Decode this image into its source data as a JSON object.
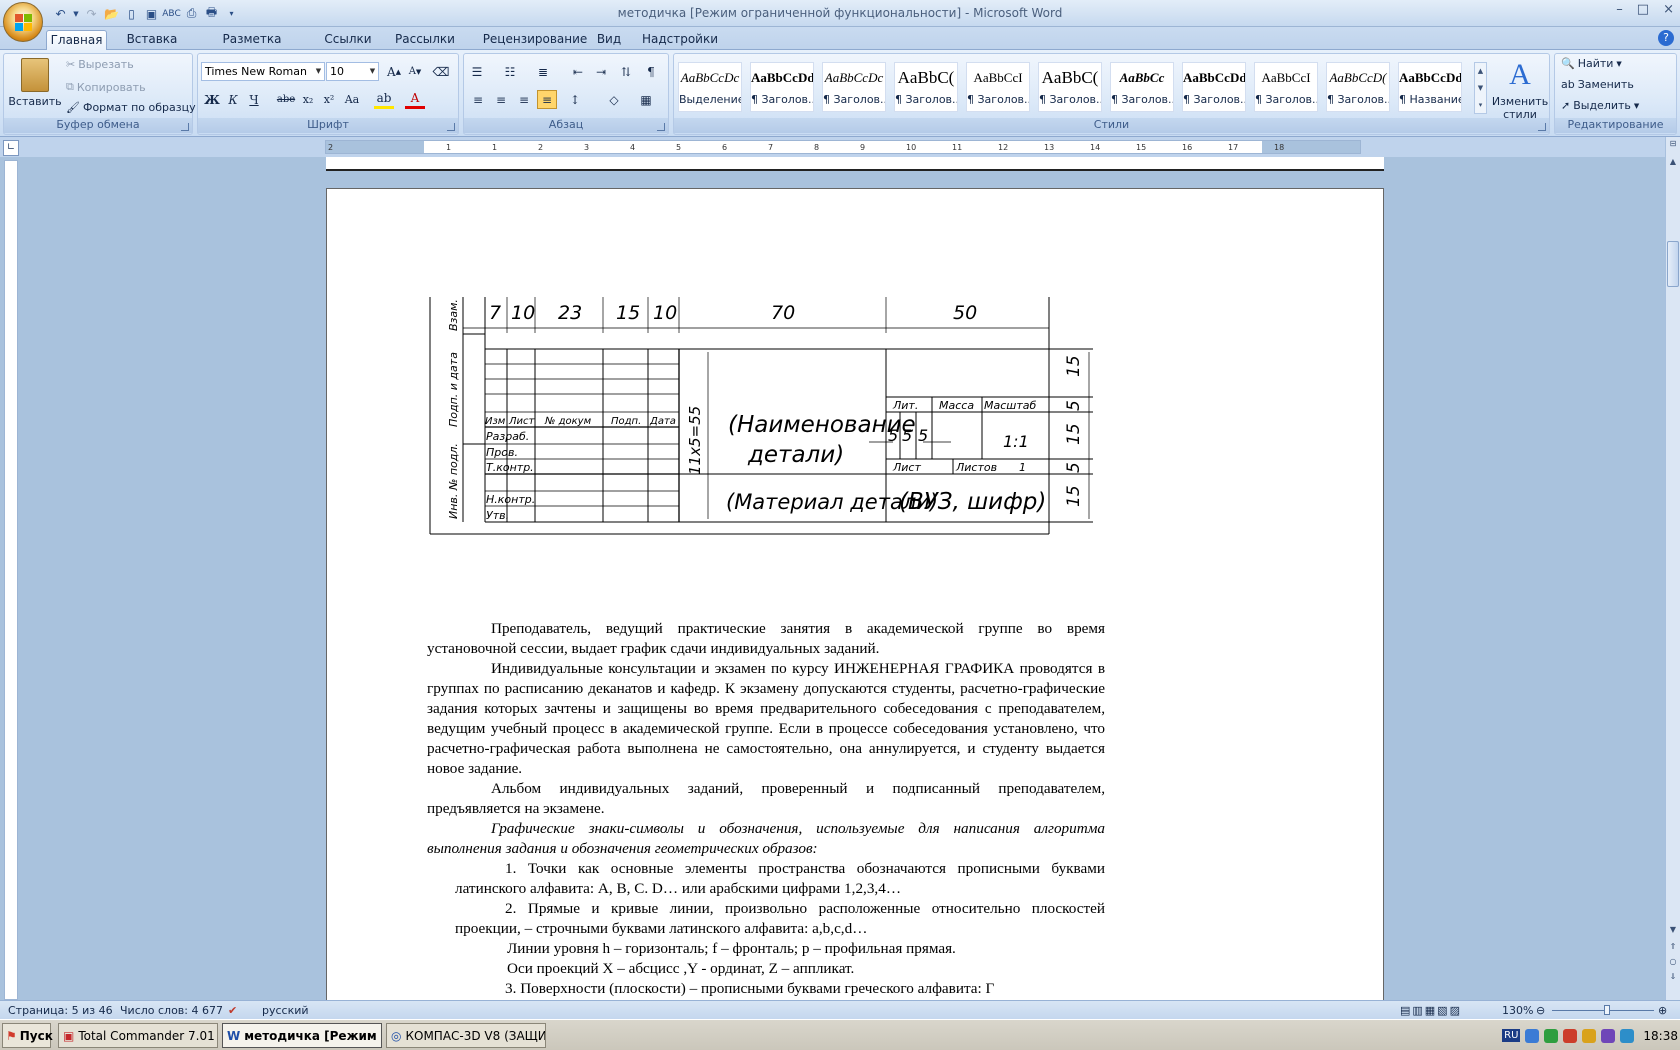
{
  "window": {
    "title": "методичка [Режим ограниченной функциональности] - Microsoft Word",
    "controls": [
      "–",
      "□",
      "×"
    ]
  },
  "tabs": [
    "Главная",
    "Вставка",
    "Разметка страницы",
    "Ссылки",
    "Рассылки",
    "Рецензирование",
    "Вид",
    "Надстройки"
  ],
  "ribbon": {
    "clipboard": {
      "label": "Буфер обмена",
      "paste": "Вставить",
      "cut": "Вырезать",
      "copy": "Копировать",
      "format_painter": "Формат по образцу"
    },
    "font": {
      "label": "Шрифт",
      "font_name": "Times New Roman",
      "font_size": "10"
    },
    "paragraph": {
      "label": "Абзац"
    },
    "styles": {
      "label": "Стили",
      "items": [
        {
          "preview": "AaBbCcDc",
          "name": "Выделение"
        },
        {
          "preview": "AaBbCcDd",
          "name": "¶ Заголов..."
        },
        {
          "preview": "AaBbCcDc",
          "name": "¶ Заголов..."
        },
        {
          "preview": "AaBbC(",
          "name": "¶ Заголов..."
        },
        {
          "preview": "AaBbCcI",
          "name": "¶ Заголов..."
        },
        {
          "preview": "AaBbC(",
          "name": "¶ Заголов..."
        },
        {
          "preview": "AaBbCc",
          "name": "¶ Заголов..."
        },
        {
          "preview": "AaBbCcDd",
          "name": "¶ Заголов..."
        },
        {
          "preview": "AaBbCcI",
          "name": "¶ Заголов..."
        },
        {
          "preview": "AaBbCcD(",
          "name": "¶ Заголов..."
        },
        {
          "preview": "AaBbCcDd",
          "name": "¶ Название"
        }
      ],
      "change_styles": "Изменить стили"
    },
    "editing": {
      "label": "Редактирование",
      "find": "Найти",
      "replace": "Заменить",
      "select": "Выделить"
    }
  },
  "ruler": {
    "ticks": [
      "2",
      "1",
      "1",
      "2",
      "3",
      "4",
      "5",
      "6",
      "7",
      "8",
      "9",
      "10",
      "11",
      "12",
      "13",
      "14",
      "15",
      "16",
      "17",
      "18"
    ]
  },
  "stamp": {
    "dims_top": [
      "7",
      "10",
      "23",
      "15",
      "10",
      "70",
      "50"
    ],
    "dims_right": [
      "15",
      "5",
      "15",
      "5",
      "15"
    ],
    "side_labels": [
      "Взам.",
      "Подп. и дата",
      "Инв. № подл."
    ],
    "header_row": [
      "Изм",
      "Лист",
      "№ докум",
      "Подп.",
      "Дата"
    ],
    "row_labels": [
      "Разраб.",
      "Пров.",
      "Т.контр.",
      "Н.контр.",
      "Утв."
    ],
    "vertical_dim": "11х5=55",
    "name_line1": "(Наименование",
    "name_line2": "детали)",
    "material": "(Материал детали)",
    "org": "(ВУЗ, шифр)",
    "lit": "Лит.",
    "mass": "Масса",
    "scale": "Масштаб",
    "lit_cells": [
      "5",
      "5",
      "5"
    ],
    "scale_value": "1:1",
    "sheet": "Лист",
    "sheets": "Листов",
    "sheets_value": "1"
  },
  "body": {
    "paragraphs": [
      {
        "cls": "",
        "text": "Преподаватель, ведущий практические занятия в академической группе во время установочной сессии, выдает график сдачи индивидуальных заданий."
      },
      {
        "cls": "",
        "text": "Индивидуальные консультации и экзамен по курсу ИНЖЕНЕРНАЯ ГРАФИКА проводятся в группах по расписанию деканатов и кафедр. К экзамену допускаются студенты, расчетно-графические задания которых зачтены и защищены во время предварительного собеседования с преподавателем, ведущим учебный процесс в академической группе. Если в процессе собеседования установлено, что расчетно-графическая работа выполнена не самостоятельно, она аннулируется, и студенту выдается новое задание."
      },
      {
        "cls": "",
        "text": "Альбом индивидуальных заданий, проверенный и подписанный преподавателем, предъявляется на экзамене."
      },
      {
        "cls": "it",
        "text": "Графические знаки-символы и обозначения, используемые для написания алгоритма выполнения задания и обозначения геометрических образов:"
      },
      {
        "cls": "li",
        "text": "1. Точки как основные элементы пространства обозначаются прописными буквами латинского алфавита: A, B, C. D… или арабскими цифрами 1,2,3,4…"
      },
      {
        "cls": "li",
        "text": "2. Прямые и кривые линии, произвольно расположенные относительно плоскостей проекции, – строчными буквами латинского алфавита: a,b,c,d…"
      },
      {
        "cls": "ln",
        "text": "Линии уровня h – горизонталь; f – фронталь; p – профильная прямая."
      },
      {
        "cls": "ln",
        "text": "Оси проекций X – абсцисс ,Y - ординат, Z – аппликат."
      },
      {
        "cls": "li",
        "text": "3. Поверхности (плоскости) – прописными буквами греческого алфавита: Г"
      }
    ]
  },
  "status": {
    "page": "Страница: 5 из 46",
    "words": "Число слов: 4 677",
    "language": "русский",
    "zoom": "130%"
  },
  "taskbar": {
    "start": "Пуск",
    "tasks": [
      "Total Commander 7.01 - ...",
      "методичка [Режим о...",
      "КОМПАС-3D V8 (ЗАЩИТ..."
    ],
    "lang": "RU",
    "time": "18:38"
  },
  "colors": {
    "ribbon": "#dbe7f6",
    "accent": "#15294a",
    "highlight": "#ffd56b"
  }
}
